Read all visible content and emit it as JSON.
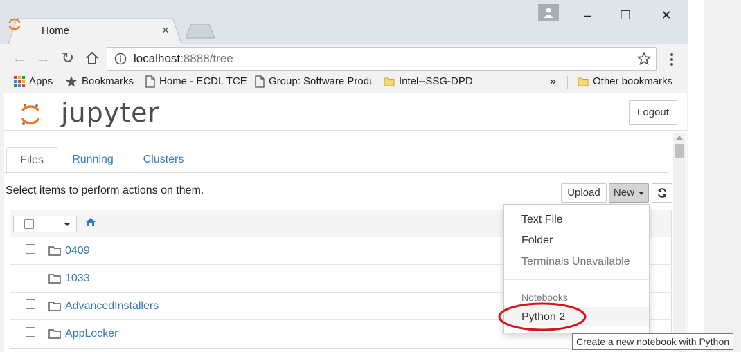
{
  "browser": {
    "tab_title": "Home",
    "tab_close": "×",
    "url_host": "localhost",
    "url_rest": ":8888/tree",
    "bookmarks": {
      "apps": "Apps",
      "bookmarks": "Bookmarks",
      "home_ecdl": "Home - ECDL TCE",
      "group_software": "Group: Software Produ",
      "intel": "Intel--SSG-DPD",
      "overflow": "»",
      "other": "Other bookmarks"
    },
    "window_controls": {
      "minimize": "–",
      "maximize": "☐",
      "close": "✕"
    }
  },
  "jupyter": {
    "logo_text": "jupyter",
    "logout_label": "Logout",
    "tabs": [
      {
        "label": "Files",
        "active": true
      },
      {
        "label": "Running",
        "active": false
      },
      {
        "label": "Clusters",
        "active": false
      }
    ],
    "select_hint": "Select items to perform actions on them.",
    "upload_label": "Upload",
    "new_label": "New",
    "files": [
      {
        "name": "0409",
        "type": "folder"
      },
      {
        "name": "1033",
        "type": "folder"
      },
      {
        "name": "AdvancedInstallers",
        "type": "folder"
      },
      {
        "name": "AppLocker",
        "type": "folder"
      }
    ],
    "new_menu": {
      "text_file": "Text File",
      "folder": "Folder",
      "terminals": "Terminals Unavailable",
      "notebooks_header": "Notebooks",
      "python2": "Python 2"
    },
    "tooltip": "Create a new notebook with Python"
  },
  "colors": {
    "link": "#337ab7",
    "highlight_ring": "#d9131b",
    "jupyter_orange": "#f37726"
  }
}
